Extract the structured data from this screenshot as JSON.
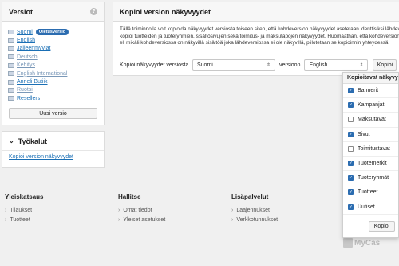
{
  "versions": {
    "title": "Versiot",
    "help_icon": "?",
    "items": [
      {
        "label": "Suomi",
        "badge": "Oletusversio",
        "muted": false
      },
      {
        "label": "English",
        "muted": false
      },
      {
        "label": "Jälleenmyyjät",
        "muted": false
      },
      {
        "label": "Deutsch",
        "muted": true
      },
      {
        "label": "Kehitys",
        "muted": true
      },
      {
        "label": "English International",
        "muted": true
      },
      {
        "label": "Anneli Butiik",
        "muted": false
      },
      {
        "label": "Ruotsi",
        "muted": true
      },
      {
        "label": "Resellers",
        "muted": false
      }
    ],
    "new_button": "Uusi versio"
  },
  "tools": {
    "title": "Työkalut",
    "link": "Kopioi version näkyvyydet"
  },
  "copy": {
    "title": "Kopioi version näkyvyydet",
    "desc_lines": [
      "Tällä toiminnolla voit kopioida näkyvyydet versiosta toiseen siten, että kohdeversion näkyvyydet asetetaan identtisiksi lähdeve",
      "kopioi tuotteiden ja tuoteryhmien, sisältösivujen sekä toimitus- ja maksutapojen näkyvyydet. Huomaathan, että kohdeversion",
      "eli mikäli kohdeversiossa on näkyvillä sisältöä joka lähdeversiossa ei ole näkyvillä, piilotetaan se kopioinnin yhteydessä."
    ],
    "from_label": "Kopioi näkyvyydet versiosta",
    "from_value": "Suomi",
    "to_label": "versioon",
    "to_value": "English",
    "button": "Kopioi"
  },
  "dropdown": {
    "title": "Kopioitavat näkyvyydet",
    "items": [
      {
        "label": "Bannerit",
        "checked": true
      },
      {
        "label": "Kampanjat",
        "checked": true
      },
      {
        "label": "Maksutavat",
        "checked": false
      },
      {
        "label": "Sivut",
        "checked": true
      },
      {
        "label": "Toimitustavat",
        "checked": false
      },
      {
        "label": "Tuotemerkit",
        "checked": true
      },
      {
        "label": "Tuoteryhmät",
        "checked": true
      },
      {
        "label": "Tuotteet",
        "checked": true
      },
      {
        "label": "Uutiset",
        "checked": true
      }
    ],
    "button": "Kopioi"
  },
  "footer": {
    "cols": [
      {
        "title": "Yleiskatsaus",
        "links": [
          "Tilaukset",
          "Tuotteet"
        ]
      },
      {
        "title": "Hallitse",
        "links": [
          "Omat tiedot",
          "Yleiset asetukset"
        ]
      },
      {
        "title": "Lisäpalvelut",
        "links": [
          "Laajennukset",
          "Verkkotunnukset"
        ]
      }
    ],
    "logo": "MyCas"
  },
  "colors": {
    "accent": "#2b6cb0",
    "link": "#1a6fb5",
    "background": "#f0f0f0"
  }
}
